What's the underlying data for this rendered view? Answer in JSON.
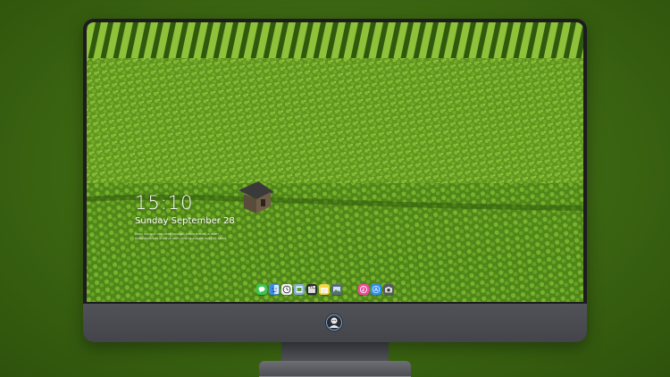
{
  "lockscreen": {
    "time": "15:10",
    "date": "Sunday September 28",
    "subtext": "Nunc congue nisi vitae suscipit tellus mauris a diam maecenas sed enim ut sem viverra aliquet eget sit amet"
  },
  "dock": {
    "items": [
      {
        "icon": "messages-icon",
        "color": "#3fc34f"
      },
      {
        "icon": "finder-icon",
        "color": "#3a8ee8"
      },
      {
        "icon": "clock-icon",
        "color": "#f2f2f2"
      },
      {
        "icon": "preview-icon",
        "color": "#7fb0d8"
      },
      {
        "icon": "clapper-icon",
        "color": "#2b2b2b"
      },
      {
        "icon": "notes-icon",
        "color": "#f5d64a"
      },
      {
        "icon": "photos-icon",
        "color": "#5a6a7a"
      },
      {
        "icon": "music-icon",
        "color": "#ee4b9c"
      },
      {
        "icon": "app-store-icon",
        "color": "#2f8ff0"
      },
      {
        "icon": "camera-icon",
        "color": "#555a60"
      }
    ]
  },
  "colors": {
    "background": "#3f6a13",
    "field": "#5a8d1c",
    "monitor_chin": "#4a4c51"
  }
}
